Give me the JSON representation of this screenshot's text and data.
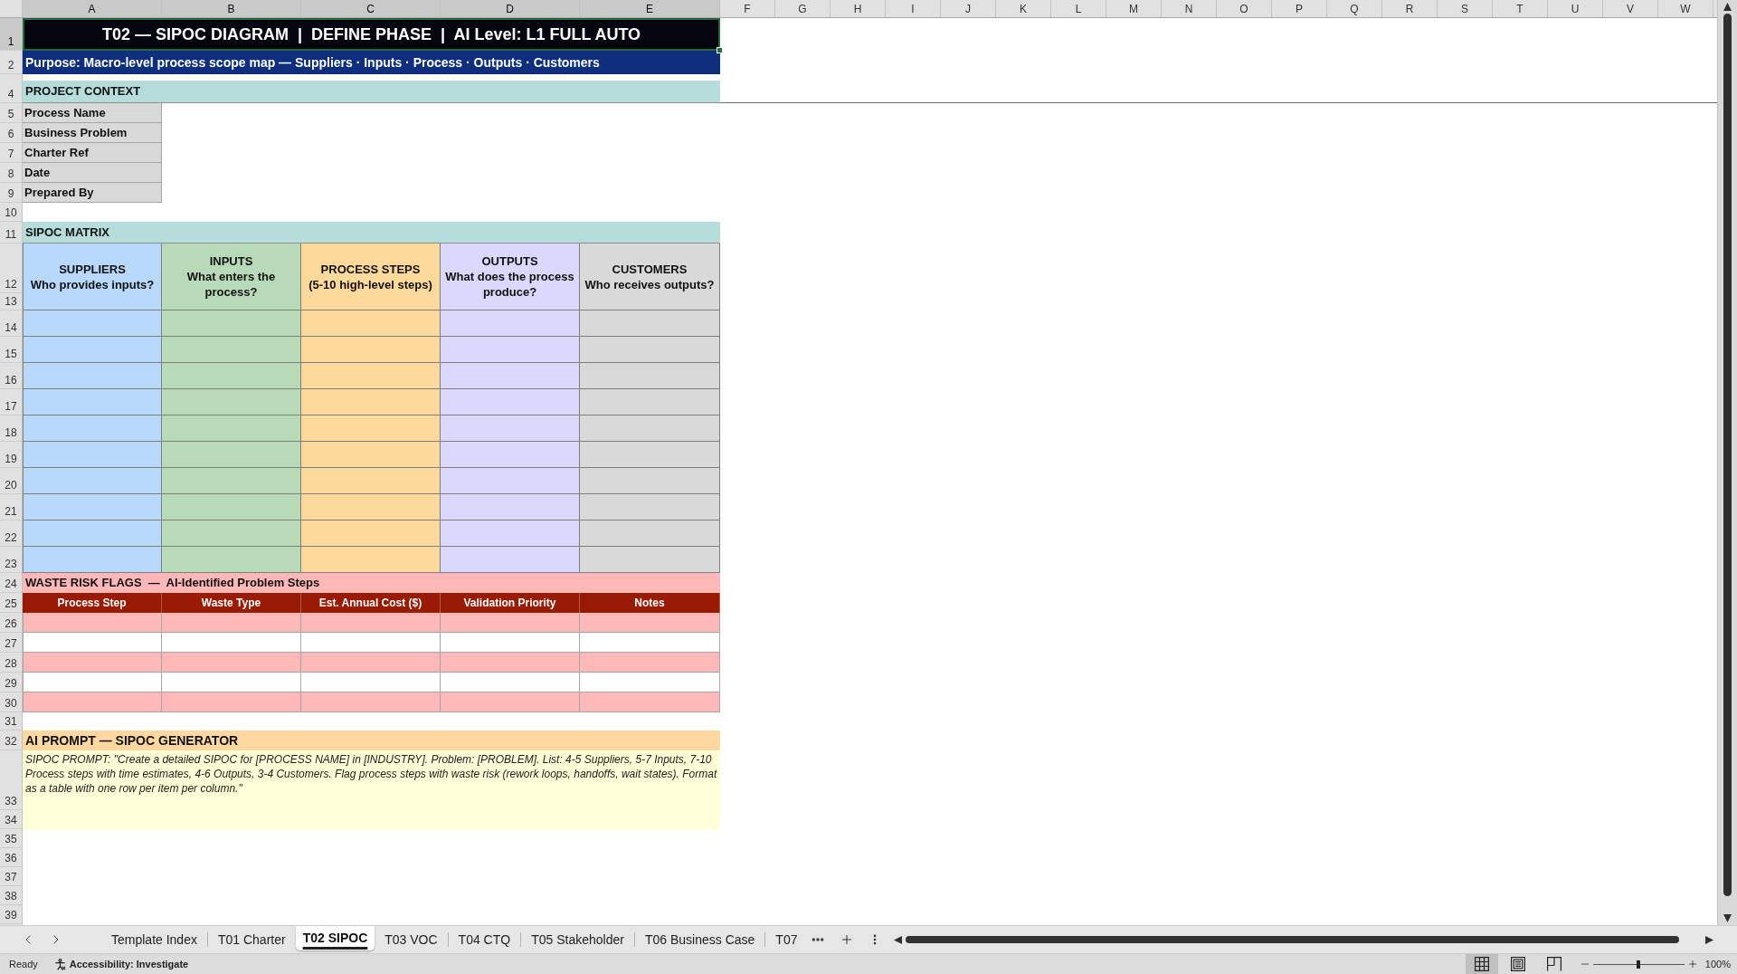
{
  "column_headers": [
    {
      "label": "A",
      "selected": true
    },
    {
      "label": "B",
      "selected": true
    },
    {
      "label": "C",
      "selected": true
    },
    {
      "label": "D",
      "selected": true
    },
    {
      "label": "E",
      "selected": true
    },
    {
      "label": "F",
      "selected": false
    },
    {
      "label": "G",
      "selected": false
    },
    {
      "label": "H",
      "selected": false
    },
    {
      "label": "I",
      "selected": false
    },
    {
      "label": "J",
      "selected": false
    },
    {
      "label": "K",
      "selected": false
    },
    {
      "label": "L",
      "selected": false
    },
    {
      "label": "M",
      "selected": false
    },
    {
      "label": "N",
      "selected": false
    },
    {
      "label": "O",
      "selected": false
    },
    {
      "label": "P",
      "selected": false
    },
    {
      "label": "Q",
      "selected": false
    },
    {
      "label": "R",
      "selected": false
    },
    {
      "label": "S",
      "selected": false
    },
    {
      "label": "T",
      "selected": false
    },
    {
      "label": "U",
      "selected": false
    },
    {
      "label": "V",
      "selected": false
    },
    {
      "label": "W",
      "selected": false
    }
  ],
  "row_headers": [
    {
      "label": "1",
      "selected": true
    },
    {
      "label": "2",
      "selected": false
    },
    {
      "label": "4",
      "selected": false
    },
    {
      "label": "5",
      "selected": false
    },
    {
      "label": "6",
      "selected": false
    },
    {
      "label": "7",
      "selected": false
    },
    {
      "label": "8",
      "selected": false
    },
    {
      "label": "9",
      "selected": false
    },
    {
      "label": "10",
      "selected": false
    },
    {
      "label": "11",
      "selected": false
    },
    {
      "label": "12",
      "selected": false
    },
    {
      "label": "13",
      "selected": false
    },
    {
      "label": "14",
      "selected": false
    },
    {
      "label": "15",
      "selected": false
    },
    {
      "label": "16",
      "selected": false
    },
    {
      "label": "17",
      "selected": false
    },
    {
      "label": "18",
      "selected": false
    },
    {
      "label": "19",
      "selected": false
    },
    {
      "label": "20",
      "selected": false
    },
    {
      "label": "21",
      "selected": false
    },
    {
      "label": "22",
      "selected": false
    },
    {
      "label": "23",
      "selected": false
    },
    {
      "label": "24",
      "selected": false
    },
    {
      "label": "25",
      "selected": false
    },
    {
      "label": "26",
      "selected": false
    },
    {
      "label": "27",
      "selected": false
    },
    {
      "label": "28",
      "selected": false
    },
    {
      "label": "29",
      "selected": false
    },
    {
      "label": "30",
      "selected": false
    },
    {
      "label": "31",
      "selected": false
    },
    {
      "label": "32",
      "selected": false
    },
    {
      "label": "33",
      "selected": false
    },
    {
      "label": "34",
      "selected": false
    },
    {
      "label": "35",
      "selected": false
    },
    {
      "label": "36",
      "selected": false
    },
    {
      "label": "37",
      "selected": false
    },
    {
      "label": "38",
      "selected": false
    },
    {
      "label": "39",
      "selected": false
    }
  ],
  "title": {
    "text": "T02 — SIPOC DIAGRAM  |  DEFINE PHASE  |  AI Level: L1 FULL AUTO",
    "selected": true
  },
  "purpose": "Purpose: Macro-level process scope map — Suppliers · Inputs · Process · Outputs · Customers",
  "project_context": {
    "heading": "PROJECT CONTEXT",
    "fields": [
      "Process Name",
      "Business Problem",
      "Charter Ref",
      "Date",
      "Prepared By"
    ]
  },
  "sipoc_matrix": {
    "heading": "SIPOC MATRIX",
    "columns": [
      {
        "title": "SUPPLIERS",
        "subtitle": "Who provides inputs?",
        "color": "#b8d8fc"
      },
      {
        "title": "INPUTS",
        "subtitle": "What enters the process?",
        "color": "#b9dab9"
      },
      {
        "title": "PROCESS STEPS",
        "subtitle": "(5-10 high-level steps)",
        "color": "#fed99c"
      },
      {
        "title": "OUTPUTS",
        "subtitle": "What does the process produce?",
        "color": "#dad9fd"
      },
      {
        "title": "CUSTOMERS",
        "subtitle": "Who receives outputs?",
        "color": "#d9d9d9"
      }
    ]
  },
  "waste_risk_flags": {
    "heading": "WASTE RISK FLAGS  —  AI-Identified Problem Steps",
    "columns": [
      "Process Step",
      "Waste Type",
      "Est. Annual Cost ($)",
      "Validation Priority",
      "Notes"
    ]
  },
  "ai_prompt": {
    "heading": "AI PROMPT — SIPOC GENERATOR",
    "text": "SIPOC PROMPT: \"Create a detailed SIPOC for [PROCESS NAME] in [INDUSTRY]. Problem: [PROBLEM]. List: 4-5 Suppliers, 5-7 Inputs, 7-10 Process steps with time estimates, 4-6 Outputs, 3-4 Customers. Flag process steps with waste risk (rework loops, handoffs, wait states). Format as a table with one row per item per column.\""
  },
  "sheet_tabs": [
    {
      "label": "Template Index",
      "selected": false
    },
    {
      "label": "T01 Charter",
      "selected": false
    },
    {
      "label": "T02 SIPOC",
      "selected": true
    },
    {
      "label": "T03 VOC",
      "selected": false
    },
    {
      "label": "T04 CTQ",
      "selected": false
    },
    {
      "label": "T05 Stakeholder",
      "selected": false
    },
    {
      "label": "T06 Business Case",
      "selected": false
    },
    {
      "label": "T07",
      "selected": false
    }
  ],
  "status_bar": {
    "status": "Ready",
    "accessibility": "Accessibility: Investigate",
    "views": [
      {
        "kind": "normal",
        "selected": true
      },
      {
        "kind": "page_layout",
        "selected": false
      },
      {
        "kind": "page_break",
        "selected": false
      }
    ],
    "zoom": {
      "level": 0.5,
      "reading": "100%"
    }
  }
}
